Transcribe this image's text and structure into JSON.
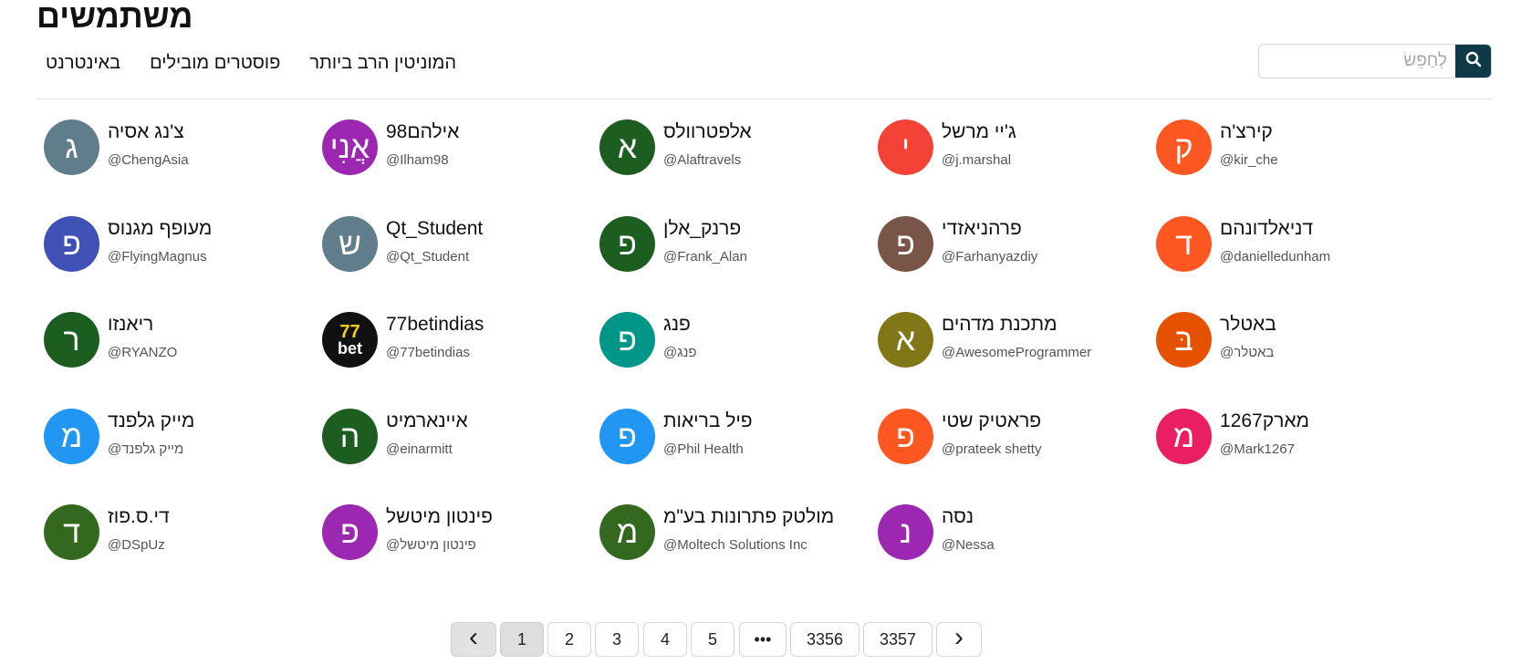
{
  "header": {
    "title": "משתמשים",
    "search_placeholder": "לְחַפֵּשׂ",
    "search_value": ""
  },
  "tabs": [
    {
      "label": "באינטרנט"
    },
    {
      "label": "פוסטרים מובילים"
    },
    {
      "label": "המוניטין הרב ביותר"
    }
  ],
  "colors": {
    "search_button": "#0e3a47",
    "active_page": "#dedede"
  },
  "users": [
    {
      "name": "צ'נג אסיה",
      "handle": "@ChengAsia",
      "initial": "ג",
      "color": "#607d8b"
    },
    {
      "name": "אילהם98",
      "handle": "@Ilham98",
      "initial": "אֲנִי",
      "color": "#9c27b0"
    },
    {
      "name": "אלפטרוולס",
      "handle": "@Alaftravels",
      "initial": "א",
      "color": "#1b5e20"
    },
    {
      "name": "ג'יי מרשל",
      "handle": "@j.marshal",
      "initial": "י",
      "color": "#f44336"
    },
    {
      "name": "קירצ'ה",
      "handle": "@kir_che",
      "initial": "ק",
      "color": "#ff5722"
    },
    {
      "name": "מעופף מגנוס",
      "handle": "@FlyingMagnus",
      "initial": "פ",
      "color": "#3f51b5"
    },
    {
      "name": "Qt_Student",
      "handle": "@Qt_Student",
      "initial": "ש",
      "color": "#607d8b"
    },
    {
      "name": "פרנק_אלן",
      "handle": "@Frank_Alan",
      "initial": "פ",
      "color": "#1b5e20"
    },
    {
      "name": "פרהניאזדי",
      "handle": "@Farhanyazdiy",
      "initial": "פ",
      "color": "#795548"
    },
    {
      "name": "דניאלדונהם",
      "handle": "@danielledunham",
      "initial": "ד",
      "color": "#ff5722"
    },
    {
      "name": "ריאנזו",
      "handle": "@RYANZO",
      "initial": "ר",
      "color": "#1b5e20"
    },
    {
      "name": "77betindias",
      "handle": "@77betindias",
      "initial": "77",
      "color": "#111111",
      "logo": true,
      "logo_text": "bet"
    },
    {
      "name": "פנג",
      "handle": "@פנג",
      "initial": "פ",
      "color": "#009688"
    },
    {
      "name": "מתכנת מדהים",
      "handle": "@AwesomeProgrammer",
      "initial": "א",
      "color": "#827717"
    },
    {
      "name": "באטלר",
      "handle": "@באטלר",
      "initial": "בּ",
      "color": "#e65100"
    },
    {
      "name": "מייק גלפנד",
      "handle": "@מייק גלפנד",
      "initial": "מ",
      "color": "#2196f3"
    },
    {
      "name": "איינארמיט",
      "handle": "@einarmitt",
      "initial": "ה",
      "color": "#1b5e20"
    },
    {
      "name": "פיל בריאות",
      "handle": "@Phil Health",
      "initial": "פ",
      "color": "#2196f3"
    },
    {
      "name": "פראטיק שטי",
      "handle": "@prateek shetty",
      "initial": "פ",
      "color": "#ff5722"
    },
    {
      "name": "מארק1267",
      "handle": "@Mark1267",
      "initial": "מ",
      "color": "#e91e63"
    },
    {
      "name": "די.ס.פוז",
      "handle": "@DSpUz",
      "initial": "ד",
      "color": "#33691e"
    },
    {
      "name": "פינטון מיטשל",
      "handle": "@פינטון מיטשל",
      "initial": "פ",
      "color": "#9c27b0"
    },
    {
      "name": "מולטק פתרונות בע\"מ",
      "handle": "@Moltech Solutions Inc",
      "initial": "מ",
      "color": "#33691e"
    },
    {
      "name": "נסה",
      "handle": "@Nessa",
      "initial": "נ",
      "color": "#9c27b0"
    }
  ],
  "pagination": {
    "prev_label": "‹",
    "pages": [
      "1",
      "2",
      "3",
      "4",
      "5",
      "•••",
      "3356",
      "3357"
    ],
    "current_page": "1",
    "next_label": "›"
  }
}
